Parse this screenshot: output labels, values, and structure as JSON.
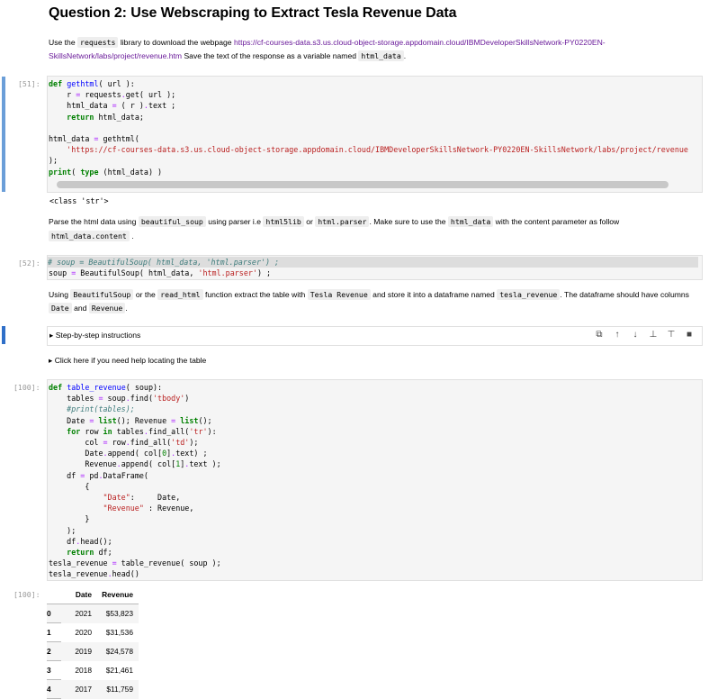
{
  "heading": "Question 2: Use Webscraping to Extract Tesla Revenue Data",
  "md1": {
    "t1": "Use the ",
    "c1": "requests",
    "t2": " library to download the webpage ",
    "link": "https://cf-courses-data.s3.us.cloud-object-storage.appdomain.cloud/IBMDeveloperSkillsNetwork-PY0220EN-SkillsNetwork/labs/project/revenue.htm",
    "t3": " Save the text of the response as a variable named ",
    "c2": "html_data",
    "t4": "."
  },
  "cell1": {
    "prompt": "[51]:",
    "lines": [
      "def gethtml( url ):",
      "    r = requests.get( url );",
      "    html_data = ( r ).text ;",
      "    return html_data;",
      "",
      "html_data = gethtml(",
      "  'https://cf-courses-data.s3.us.cloud-object-storage.appdomain.cloud/IBMDeveloperSkillsNetwork-PY0220EN-SkillsNetwork/labs/project/revenue",
      ");",
      "print( type (html_data) )"
    ],
    "output": "<class 'str'>"
  },
  "md2": {
    "t1": "Parse the html data using ",
    "c1": "beautiful_soup",
    "t2": " using parser i.e ",
    "c2": "html5lib",
    "t3": " or ",
    "c3": "html.parser",
    "t4": ". Make sure to use the ",
    "c4": "html_data",
    "t5": " with the content parameter as follow ",
    "c5": "html_data.content",
    "t6": " ."
  },
  "cell2": {
    "prompt": "[52]:",
    "line1": "# soup = BeautifulSoup( html_data, 'html.parser') ;",
    "line2": "soup = BeautifulSoup( html_data, 'html.parser') ;"
  },
  "md3": {
    "t1": "Using ",
    "c1": "BeautifulSoup",
    "t2": " or the ",
    "c2": "read_html",
    "t3": " function extract the table with ",
    "c3": "Tesla Revenue",
    "t4": " and store it into a dataframe named ",
    "c4": "tesla_revenue",
    "t5": ". The dataframe should have columns ",
    "c5": "Date",
    "t6": " and ",
    "c6": "Revenue",
    "t7": "."
  },
  "collapsed1": "▸ Step-by-step instructions",
  "collapsed2": "▸ Click here if you need help locating the table",
  "toolbar_icons": [
    "duplicate-icon",
    "move-up-icon",
    "move-down-icon",
    "insert-above-icon",
    "insert-below-icon",
    "delete-icon"
  ],
  "cell3": {
    "prompt": "[100]:",
    "lines": [
      "def table_revenue( soup):",
      "    tables = soup.find('tbody')",
      "    #print(tables);",
      "    Date = list(); Revenue = list();",
      "    for row in tables.find_all('tr'):",
      "        col = row.find_all('td');",
      "        Date.append( col[0].text) ;",
      "        Revenue.append( col[1].text );",
      "    df = pd.DataFrame(",
      "        {",
      "            \"Date\":     Date,",
      "            \"Revenue\" : Revenue,",
      "        }",
      "    );",
      "    df.head();",
      "    return df;",
      "tesla_revenue = table_revenue( soup );",
      "tesla_revenue.head()"
    ]
  },
  "output3": {
    "prompt": "[100]:",
    "columns": [
      "Date",
      "Revenue"
    ],
    "rows": [
      {
        "idx": "0",
        "date": "2021",
        "rev": "$53,823"
      },
      {
        "idx": "1",
        "date": "2020",
        "rev": "$31,536"
      },
      {
        "idx": "2",
        "date": "2019",
        "rev": "$24,578"
      },
      {
        "idx": "3",
        "date": "2018",
        "rev": "$21,461"
      },
      {
        "idx": "4",
        "date": "2017",
        "rev": "$11,759"
      }
    ]
  }
}
